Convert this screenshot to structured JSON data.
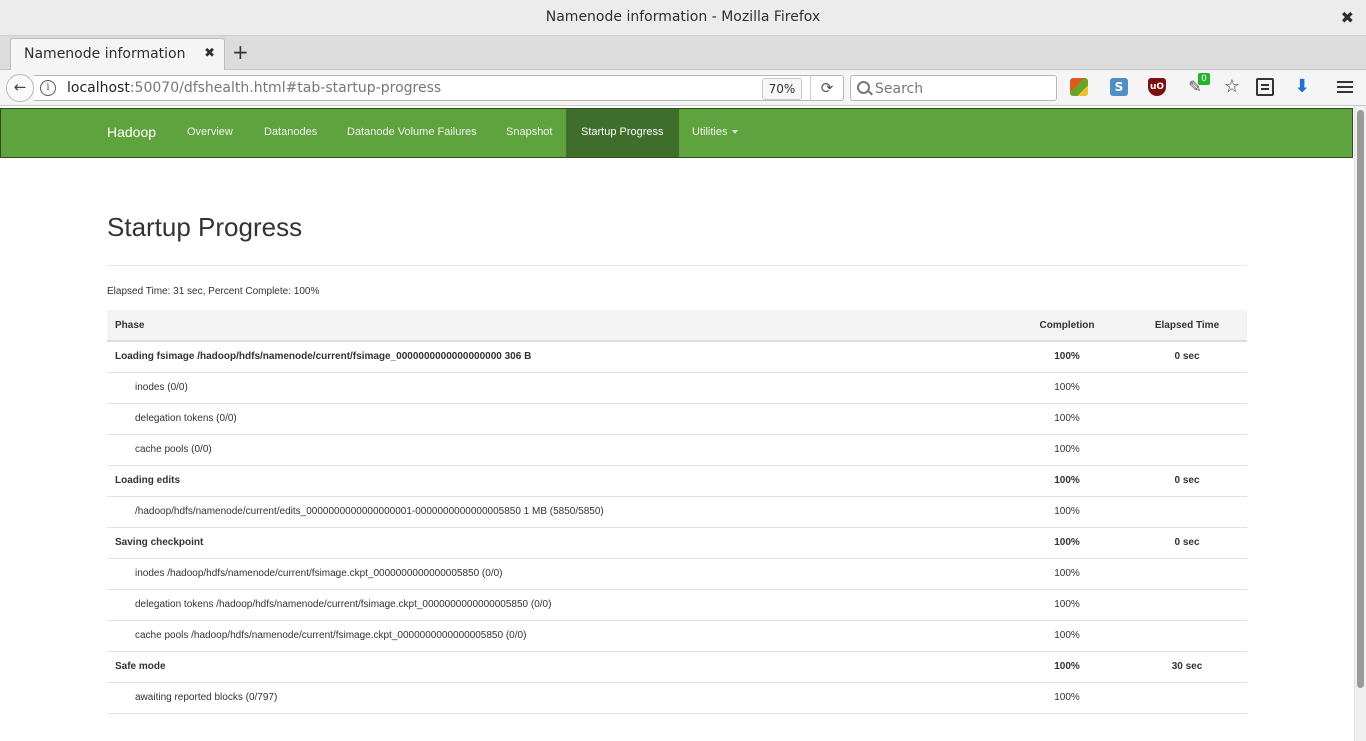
{
  "window": {
    "title": "Namenode information - Mozilla Firefox",
    "close_glyph": "✖"
  },
  "tabs": [
    {
      "label": "Namenode information",
      "close_glyph": "✖"
    }
  ],
  "toolbar": {
    "new_tab_glyph": "+",
    "back_glyph": "←",
    "url_host": "localhost",
    "url_rest": ":50070/dfshealth.html#tab-startup-progress",
    "zoom": "70%",
    "reload_glyph": "⟳",
    "search_placeholder": "Search",
    "extension_s_label": "S",
    "extension_ublock_label": "uO",
    "extension_badge": "0",
    "extension_icons": [
      "colorful-extension-icon",
      "s-extension-icon",
      "ublock-icon",
      "feather-extension-icon"
    ],
    "colors": {
      "accent": "#1e6fd8"
    }
  },
  "hadoop_nav": {
    "brand": "Hadoop",
    "items": [
      {
        "label": "Overview",
        "active": false
      },
      {
        "label": "Datanodes",
        "active": false
      },
      {
        "label": "Datanode Volume Failures",
        "active": false
      },
      {
        "label": "Snapshot",
        "active": false
      },
      {
        "label": "Startup Progress",
        "active": true
      },
      {
        "label": "Utilities",
        "active": false,
        "dropdown": true
      }
    ],
    "colors": {
      "bar": "#5fa33e",
      "active": "#3f6d2b"
    }
  },
  "page": {
    "title": "Startup Progress",
    "elapsed_summary": "Elapsed Time: 31 sec, Percent Complete: 100%"
  },
  "table": {
    "headers": [
      "Phase",
      "Completion",
      "Elapsed Time"
    ],
    "rows": [
      {
        "type": "phase",
        "phase": "Loading fsimage /hadoop/hdfs/namenode/current/fsimage_0000000000000000000 306 B",
        "completion": "100%",
        "elapsed": "0 sec"
      },
      {
        "type": "step",
        "phase": "inodes (0/0)",
        "completion": "100%",
        "elapsed": ""
      },
      {
        "type": "step",
        "phase": "delegation tokens (0/0)",
        "completion": "100%",
        "elapsed": ""
      },
      {
        "type": "step",
        "phase": "cache pools (0/0)",
        "completion": "100%",
        "elapsed": ""
      },
      {
        "type": "phase",
        "phase": "Loading edits",
        "completion": "100%",
        "elapsed": "0 sec"
      },
      {
        "type": "step",
        "phase": "/hadoop/hdfs/namenode/current/edits_0000000000000000001-0000000000000005850 1 MB (5850/5850)",
        "completion": "100%",
        "elapsed": ""
      },
      {
        "type": "phase",
        "phase": "Saving checkpoint",
        "completion": "100%",
        "elapsed": "0 sec"
      },
      {
        "type": "step",
        "phase": "inodes /hadoop/hdfs/namenode/current/fsimage.ckpt_0000000000000005850 (0/0)",
        "completion": "100%",
        "elapsed": ""
      },
      {
        "type": "step",
        "phase": "delegation tokens /hadoop/hdfs/namenode/current/fsimage.ckpt_0000000000000005850 (0/0)",
        "completion": "100%",
        "elapsed": ""
      },
      {
        "type": "step",
        "phase": "cache pools /hadoop/hdfs/namenode/current/fsimage.ckpt_0000000000000005850 (0/0)",
        "completion": "100%",
        "elapsed": ""
      },
      {
        "type": "phase",
        "phase": "Safe mode",
        "completion": "100%",
        "elapsed": "30 sec"
      },
      {
        "type": "step",
        "phase": "awaiting reported blocks (0/797)",
        "completion": "100%",
        "elapsed": ""
      }
    ]
  }
}
